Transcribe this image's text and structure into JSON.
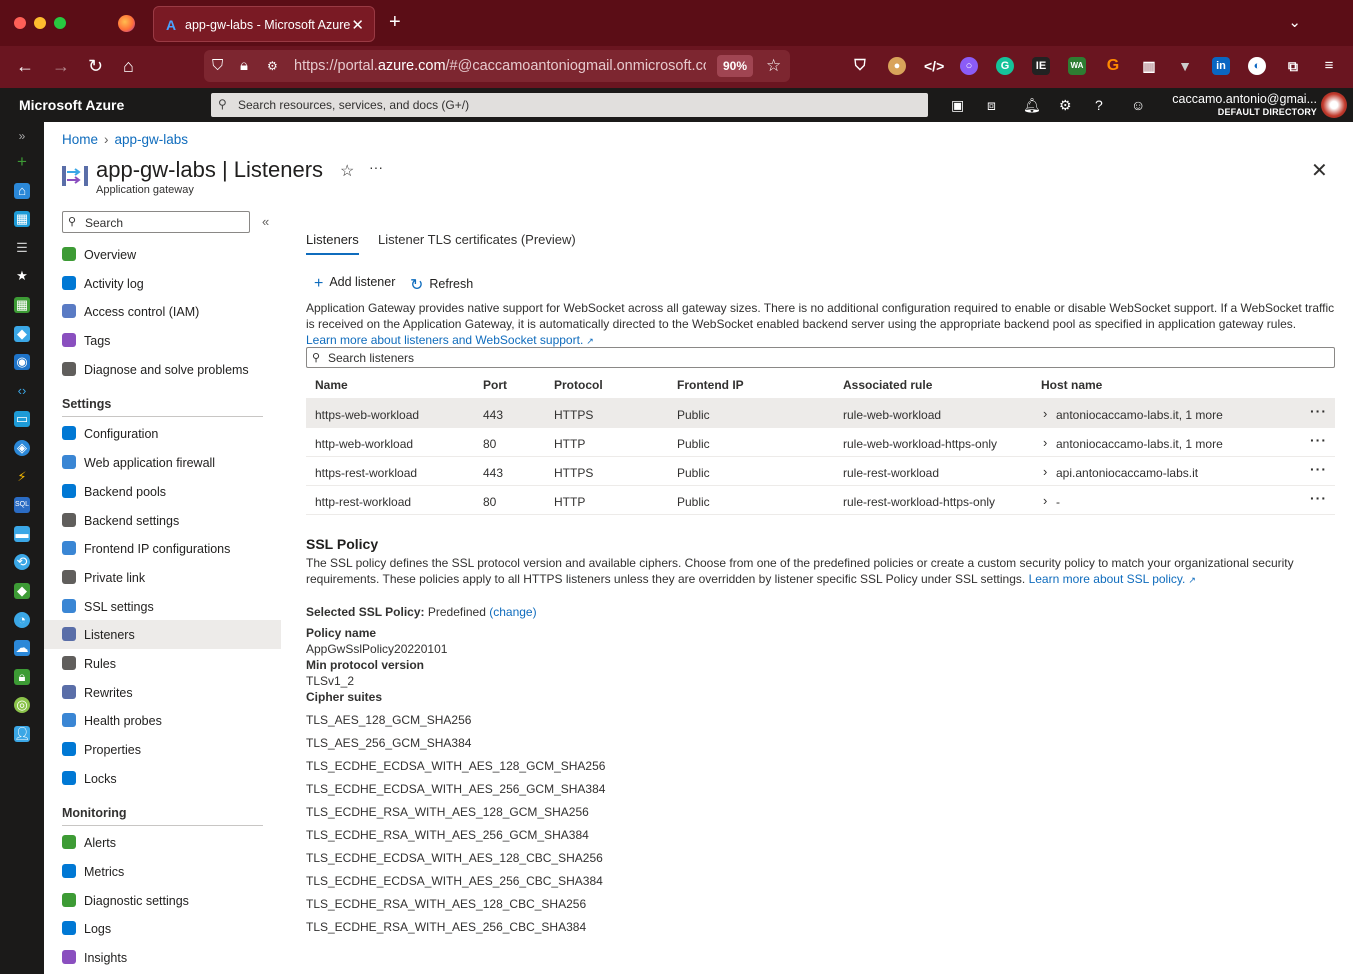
{
  "browser": {
    "tab_title": "app-gw-labs - Microsoft Azure",
    "url_prefix": "https://portal.",
    "url_domain": "azure.com",
    "url_rest": "/#@caccamoantoniogmail.onmicrosoft.co",
    "zoom": "90%"
  },
  "azure": {
    "brand": "Microsoft Azure",
    "search_placeholder": "Search resources, services, and docs (G+/)",
    "user_name": "caccamo.antonio@gmai...",
    "user_directory": "DEFAULT DIRECTORY"
  },
  "breadcrumb": [
    "Home",
    "app-gw-labs"
  ],
  "resource": {
    "title": "app-gw-labs | Listeners",
    "subtitle": "Application gateway"
  },
  "menu": {
    "search_placeholder": "Search",
    "items_top": [
      {
        "label": "Overview",
        "icon": "overview-icon",
        "color": "#3d9b35"
      },
      {
        "label": "Activity log",
        "icon": "activity-log-icon",
        "color": "#0078d4"
      },
      {
        "label": "Access control (IAM)",
        "icon": "iam-icon",
        "color": "#5a7bc4"
      },
      {
        "label": "Tags",
        "icon": "tag-icon",
        "color": "#8a4fbf"
      },
      {
        "label": "Diagnose and solve problems",
        "icon": "wrench-icon",
        "color": "#605e5c"
      }
    ],
    "settings_header": "Settings",
    "items_settings": [
      {
        "label": "Configuration",
        "icon": "configuration-icon",
        "color": "#0078d4"
      },
      {
        "label": "Web application firewall",
        "icon": "shield-icon",
        "color": "#3a86d4"
      },
      {
        "label": "Backend pools",
        "icon": "backend-pools-icon",
        "color": "#0078d4"
      },
      {
        "label": "Backend settings",
        "icon": "backend-settings-icon",
        "color": "#605e5c"
      },
      {
        "label": "Frontend IP configurations",
        "icon": "frontend-ip-icon",
        "color": "#3a86d4"
      },
      {
        "label": "Private link",
        "icon": "private-link-icon",
        "color": "#605e5c"
      },
      {
        "label": "SSL settings",
        "icon": "ssl-shield-icon",
        "color": "#3a86d4"
      },
      {
        "label": "Listeners",
        "icon": "listeners-icon",
        "color": "#5a6ea8"
      },
      {
        "label": "Rules",
        "icon": "rules-icon",
        "color": "#605e5c"
      },
      {
        "label": "Rewrites",
        "icon": "rewrites-icon",
        "color": "#5a6ea8"
      },
      {
        "label": "Health probes",
        "icon": "health-probes-icon",
        "color": "#3a86d4"
      },
      {
        "label": "Properties",
        "icon": "properties-icon",
        "color": "#0078d4"
      },
      {
        "label": "Locks",
        "icon": "lock-icon",
        "color": "#0078d4"
      }
    ],
    "monitoring_header": "Monitoring",
    "items_monitoring": [
      {
        "label": "Alerts",
        "icon": "alerts-icon",
        "color": "#3d9b35"
      },
      {
        "label": "Metrics",
        "icon": "metrics-icon",
        "color": "#0078d4"
      },
      {
        "label": "Diagnostic settings",
        "icon": "diagnostic-settings-icon",
        "color": "#3d9b35"
      },
      {
        "label": "Logs",
        "icon": "logs-icon",
        "color": "#0078d4"
      },
      {
        "label": "Insights",
        "icon": "insights-icon",
        "color": "#8a4fbf"
      }
    ]
  },
  "tabs": [
    "Listeners",
    "Listener TLS certificates (Preview)"
  ],
  "toolbar": {
    "add": "Add listener",
    "refresh": "Refresh"
  },
  "info": {
    "text": "Application Gateway provides native support for WebSocket across all gateway sizes. There is no additional configuration required to enable or disable WebSocket support. If a WebSocket traffic is received on the Application Gateway, it is automatically directed to the WebSocket enabled backend server using the appropriate backend pool as specified in application gateway rules.",
    "link": "Learn more about listeners and WebSocket support."
  },
  "list_search_placeholder": "Search listeners",
  "table": {
    "headers": [
      "Name",
      "Port",
      "Protocol",
      "Frontend IP",
      "Associated rule",
      "Host name"
    ],
    "rows": [
      [
        "https-web-workload",
        "443",
        "HTTPS",
        "Public",
        "rule-web-workload",
        "antoniocaccamo-labs.it, 1 more"
      ],
      [
        "http-web-workload",
        "80",
        "HTTP",
        "Public",
        "rule-web-workload-https-only",
        "antoniocaccamo-labs.it, 1 more"
      ],
      [
        "https-rest-workload",
        "443",
        "HTTPS",
        "Public",
        "rule-rest-workload",
        "api.antoniocaccamo-labs.it"
      ],
      [
        "http-rest-workload",
        "80",
        "HTTP",
        "Public",
        "rule-rest-workload-https-only",
        "-"
      ]
    ]
  },
  "ssl": {
    "title": "SSL Policy",
    "desc": "The SSL policy defines the SSL protocol version and available ciphers. Choose from one of the predefined policies or create a custom security policy to match your organizational security requirements. These policies apply to all HTTPS listeners unless they are overridden by listener specific SSL Policy under SSL settings.",
    "desc_link": "Learn more about SSL policy.",
    "selected_label": "Selected SSL Policy:",
    "selected_value": "Predefined",
    "change": "(change)",
    "policy_name_label": "Policy name",
    "policy_name": "AppGwSslPolicy20220101",
    "min_proto_label": "Min protocol version",
    "min_proto": "TLSv1_2",
    "cipher_label": "Cipher suites",
    "ciphers": [
      "TLS_AES_128_GCM_SHA256",
      "TLS_AES_256_GCM_SHA384",
      "TLS_ECDHE_ECDSA_WITH_AES_128_GCM_SHA256",
      "TLS_ECDHE_ECDSA_WITH_AES_256_GCM_SHA384",
      "TLS_ECDHE_RSA_WITH_AES_128_GCM_SHA256",
      "TLS_ECDHE_RSA_WITH_AES_256_GCM_SHA384",
      "TLS_ECDHE_ECDSA_WITH_AES_128_CBC_SHA256",
      "TLS_ECDHE_ECDSA_WITH_AES_256_CBC_SHA384",
      "TLS_ECDHE_RSA_WITH_AES_128_CBC_SHA256",
      "TLS_ECDHE_RSA_WITH_AES_256_CBC_SHA384"
    ]
  }
}
